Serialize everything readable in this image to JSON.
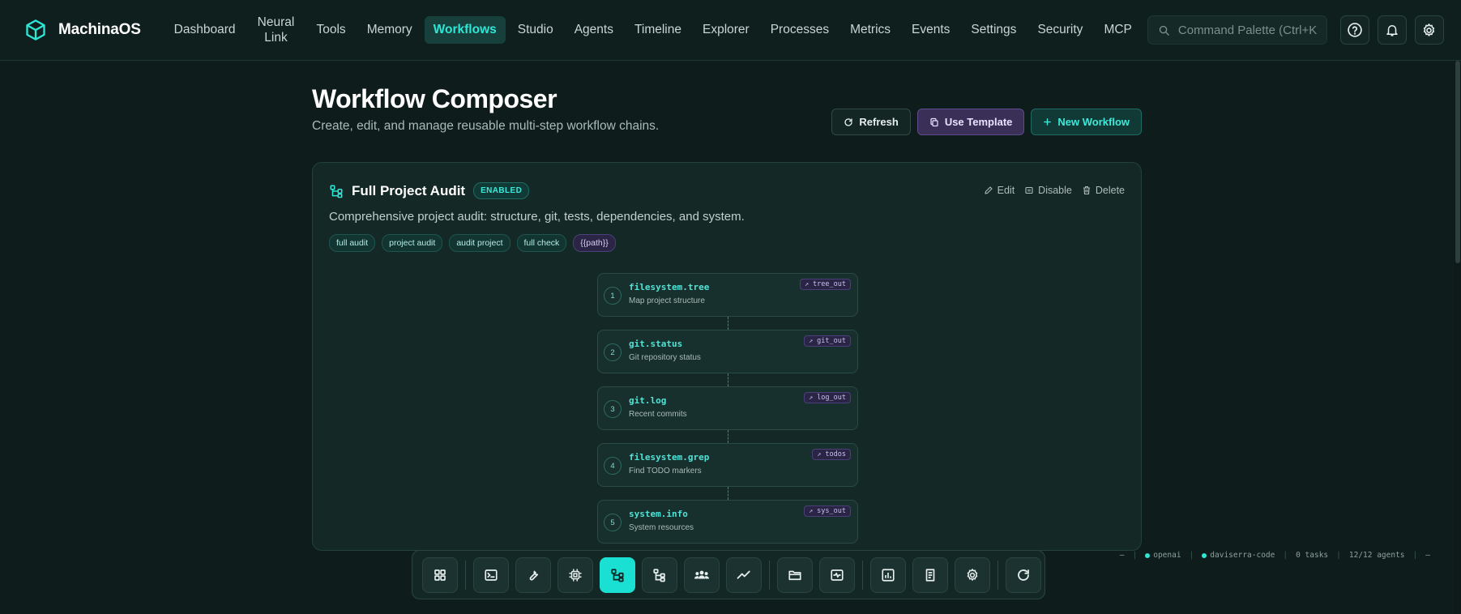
{
  "brand": {
    "name": "MachinaOS"
  },
  "nav": {
    "items": [
      {
        "label": "Dashboard"
      },
      {
        "label": "Neural Link"
      },
      {
        "label": "Tools"
      },
      {
        "label": "Memory"
      },
      {
        "label": "Workflows",
        "active": true
      },
      {
        "label": "Studio"
      },
      {
        "label": "Agents"
      },
      {
        "label": "Timeline"
      },
      {
        "label": "Explorer"
      },
      {
        "label": "Processes"
      },
      {
        "label": "Metrics"
      },
      {
        "label": "Events"
      },
      {
        "label": "Settings"
      },
      {
        "label": "Security"
      },
      {
        "label": "MCP"
      }
    ],
    "search_placeholder": "Command Palette (Ctrl+K"
  },
  "header": {
    "title": "Workflow Composer",
    "subtitle": "Create, edit, and manage reusable multi-step workflow chains.",
    "refresh_label": "Refresh",
    "template_label": "Use Template",
    "new_label": "New Workflow"
  },
  "workflow": {
    "title": "Full Project Audit",
    "status": "ENABLED",
    "edit_label": "Edit",
    "disable_label": "Disable",
    "delete_label": "Delete",
    "description": "Comprehensive project audit: structure, git, tests, dependencies, and system.",
    "tags": [
      "full audit",
      "project audit",
      "audit project",
      "full check",
      "{{path}}"
    ],
    "steps": [
      {
        "num": "1",
        "tool": "filesystem.tree",
        "desc": "Map project structure",
        "out": "↗ tree_out"
      },
      {
        "num": "2",
        "tool": "git.status",
        "desc": "Git repository status",
        "out": "↗ git_out"
      },
      {
        "num": "3",
        "tool": "git.log",
        "desc": "Recent commits",
        "out": "↗ log_out"
      },
      {
        "num": "4",
        "tool": "filesystem.grep",
        "desc": "Find TODO markers",
        "out": "↗ todos"
      },
      {
        "num": "5",
        "tool": "system.info",
        "desc": "System resources",
        "out": "↗ sys_out"
      }
    ]
  },
  "statusbar": {
    "dash_left": "–",
    "provider": "openai",
    "user": "daviserra-code",
    "tasks": "0 tasks",
    "agents": "12/12 agents",
    "dash_right": "–"
  },
  "colors": {
    "accent": "#19e0d3",
    "background": "#0e1d1c",
    "card": "#142826",
    "purple": "#3a2f57"
  }
}
